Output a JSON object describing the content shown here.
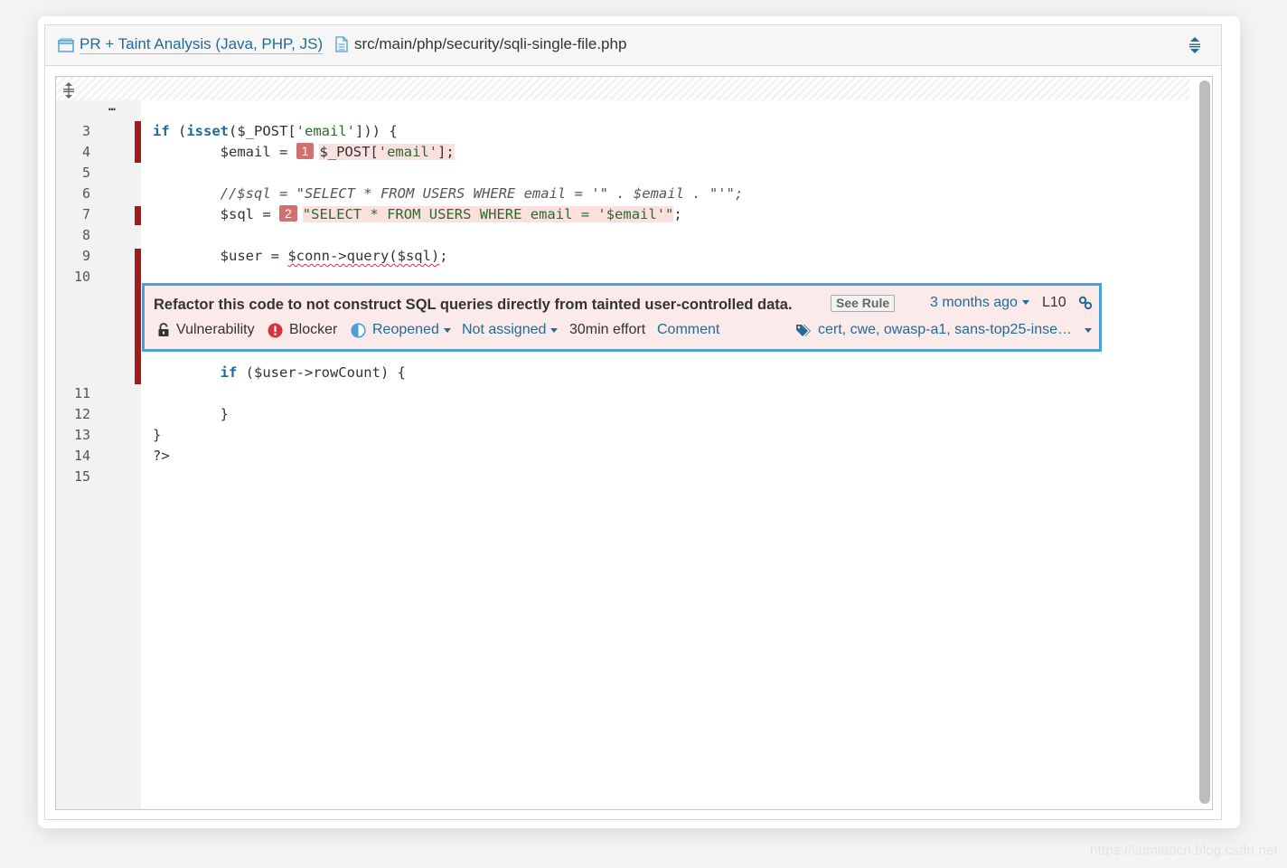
{
  "header": {
    "project_label": "PR + Taint Analysis (Java, PHP, JS)",
    "file_path": "src/main/php/security/sqli-single-file.php",
    "project_icon": "project-icon",
    "file_icon": "file-icon",
    "expand_icon": "expand-icon"
  },
  "code": {
    "ellipsis": "…",
    "lines": [
      {
        "num": "3"
      },
      {
        "num": "4"
      },
      {
        "num": "5"
      },
      {
        "num": "6"
      },
      {
        "num": "7"
      },
      {
        "num": "8"
      },
      {
        "num": "9"
      },
      {
        "num": "10"
      },
      {
        "num": "11"
      },
      {
        "num": "12"
      },
      {
        "num": "13"
      },
      {
        "num": "14"
      },
      {
        "num": "15"
      }
    ],
    "tokens": {
      "l4_if": "if",
      "l4_a": " (",
      "l4_isset": "isset",
      "l4_b": "($_POST[",
      "l4_str": "'email'",
      "l4_c": "])) {",
      "l5_a": "        $email = ",
      "loc1": "1",
      "l5_b": "$_POST[",
      "l5_str": "'email'",
      "l5_c": "];",
      "l7_cmt": "        //$sql = \"SELECT * FROM USERS WHERE email = '\" . $email . \"'\";",
      "l8_a": "        $sql = ",
      "loc2": "2",
      "l8_str": "\"SELECT * FROM USERS WHERE email = '$email'\"",
      "l8_c": ";",
      "l10_a": "        $user = ",
      "l10_b": "$conn->query($sql)",
      "l10_c": ";",
      "l11_a": "        ",
      "l11_if": "if",
      "l11_b": " ($user->rowCount) {",
      "l13": "        }",
      "l14": "}",
      "l15": "?>"
    }
  },
  "issue": {
    "message": "Refactor this code to not construct SQL queries directly from tainted user-controlled data.",
    "see_rule": "See Rule",
    "date": "3 months ago",
    "line": "L10",
    "type": "Vulnerability",
    "severity": "Blocker",
    "status": "Reopened",
    "assignee": "Not assigned",
    "effort": "30min effort",
    "comment": "Comment",
    "tags": "cert, cwe, owasp-a1, sans-top25-inse…",
    "type_icon": "lock-icon",
    "severity_icon": "blocker-icon",
    "status_icon": "reopened-icon",
    "tags_icon": "tags-icon",
    "link_icon": "link-icon"
  },
  "watermark": "https://liumiaocn.blog.csdn.net",
  "colors": {
    "link": "#236a97",
    "issue_marker": "#a01c1c",
    "issue_bg": "#fbeaea",
    "issue_border": "#4b9fd5",
    "location_badge": "#d26f6f"
  }
}
